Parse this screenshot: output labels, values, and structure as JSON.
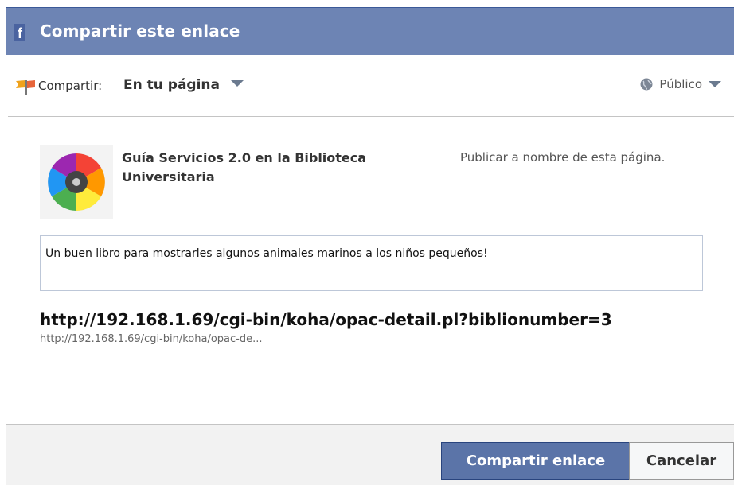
{
  "header": {
    "title": "Compartir este enlace",
    "logo_glyph": "f"
  },
  "toolbar": {
    "share_label": "Compartir:",
    "share_target": "En tu página",
    "audience": "Público"
  },
  "page": {
    "name": "Guía Servicios 2.0 en la Biblioteca Universitaria",
    "publish_as": "Publicar a nombre de esta página."
  },
  "message": {
    "value": "Un buen libro para mostrarles algunos animales marinos a los niños pequeños!"
  },
  "link": {
    "title": "http://192.168.1.69/cgi-bin/koha/opac-detail.pl?biblionumber=3",
    "url": "http://192.168.1.69/cgi-bin/koha/opac-de..."
  },
  "footer": {
    "share_button": "Compartir enlace",
    "cancel_button": "Cancelar"
  },
  "colors": {
    "header_bg": "#6d84b4",
    "primary_button": "#5b74a8"
  }
}
